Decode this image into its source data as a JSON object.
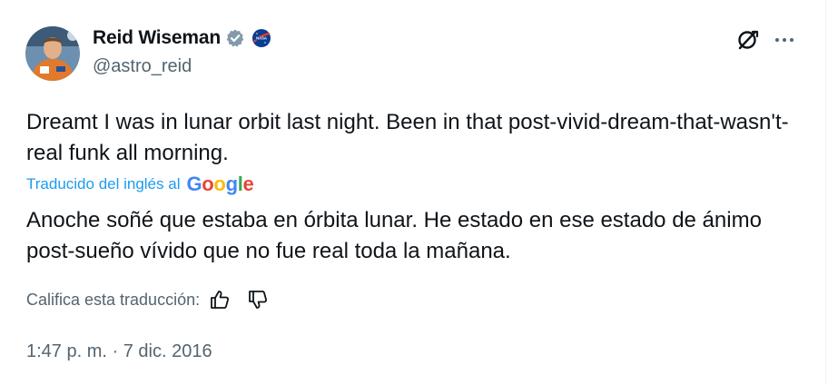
{
  "post": {
    "author": {
      "name": "Reid Wiseman",
      "handle": "@astro_reid",
      "verified_icon": "verified-badge-icon",
      "org_icon": "nasa-logo-icon"
    },
    "text": "Dreamt I was in lunar orbit last night. Been in that post-vivid-dream-that-wasn't-real funk all morning.",
    "translation": {
      "label": "Traducido del inglés al",
      "provider": "Google",
      "text": "Anoche soñé que estaba en órbita lunar. He estado en ese estado de ánimo post-sueño vívido que no fue real toda la mañana.",
      "rate_label": "Califica esta traducción:"
    },
    "timestamp": "1:47 p. m. · 7 dic. 2016"
  },
  "colors": {
    "text": "#0f1419",
    "secondary": "#536471",
    "link": "#1d9bf0"
  }
}
